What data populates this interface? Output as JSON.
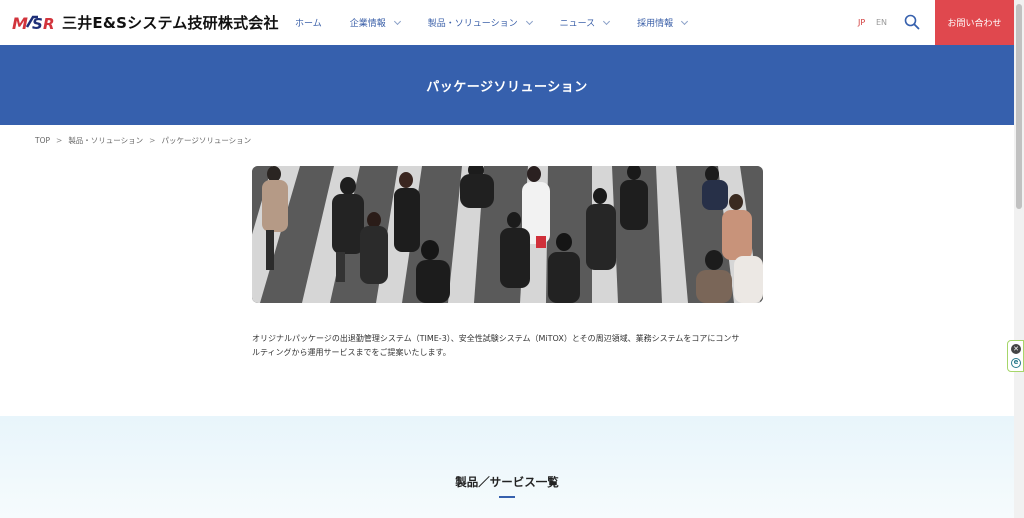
{
  "header": {
    "logo_mark": "MSR",
    "company_name": "三井E&Sシステム技研株式会社",
    "nav": [
      {
        "label": "ホーム",
        "dropdown": false
      },
      {
        "label": "企業情報",
        "dropdown": true
      },
      {
        "label": "製品・ソリューション",
        "dropdown": true
      },
      {
        "label": "ニュース",
        "dropdown": true
      },
      {
        "label": "採用情報",
        "dropdown": true
      }
    ],
    "lang_jp": "JP",
    "lang_en": "EN",
    "contact_label": "お問い合わせ"
  },
  "hero": {
    "title": "パッケージソリューション"
  },
  "breadcrumb": [
    "TOP",
    "製品・ソリューション",
    "パッケージソリューション"
  ],
  "breadcrumb_sep": ">",
  "main": {
    "description_line1": "オリジナルパッケージの出退勤管理システム（TIME-3）、安全性試験システム（MiTOX）とその周辺領域、業務システムをコアにコンサ",
    "description_line2": "ルティングから運用サービスまでをご提案いたします。"
  },
  "section": {
    "title": "製品／サービス一覧"
  },
  "colors": {
    "brand_blue": "#3660ad",
    "contact_red": "#e0484e",
    "lang_active": "#d23c3c",
    "section_bg": "#e8f5fb"
  },
  "icons": {
    "search": "search-icon",
    "chevron": "chevron-down-icon",
    "widget_close": "close-icon",
    "widget_e": "edge-icon"
  },
  "widget": {
    "close_glyph": "✕",
    "e_glyph": "e"
  }
}
